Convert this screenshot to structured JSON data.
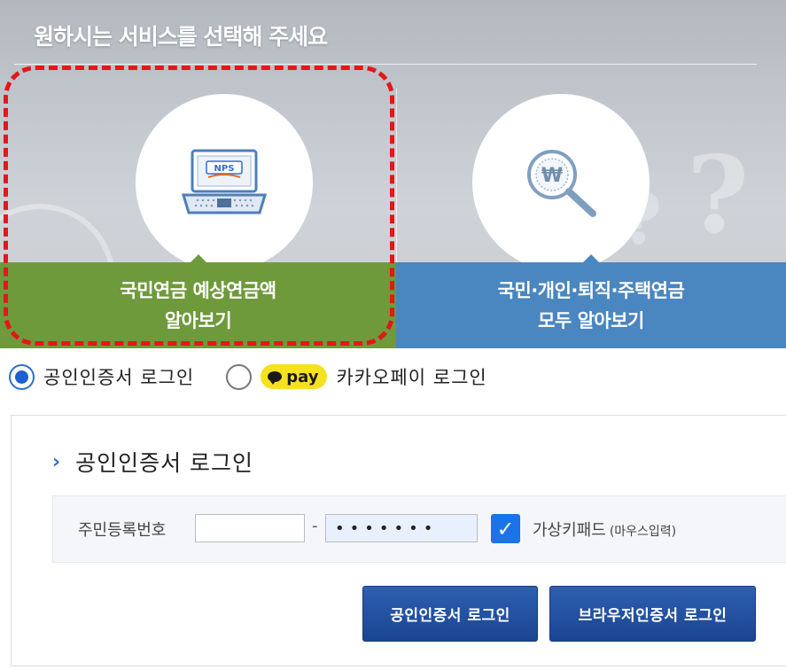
{
  "banner": {
    "title": "원하시는 서비스를 선택해 주세요",
    "cards": [
      {
        "line1": "국민연금 예상연금액",
        "line2": "알아보기",
        "icon": "laptop-nps-icon",
        "icon_text": "NPS",
        "color": "#6e9a3c"
      },
      {
        "line1": "국민·개인·퇴직·주택연금",
        "line2": "모두 알아보기",
        "icon": "magnifier-won-icon",
        "icon_text": "₩",
        "color": "#4a86c0"
      }
    ],
    "highlight_color": "#e3171a"
  },
  "login_methods": {
    "cert_label": "공인인증서 로그인",
    "kakao_badge": "pay",
    "kakao_label": "카카오페이 로그인",
    "selected": "cert"
  },
  "panel": {
    "title": "공인인증서 로그인",
    "id_label": "주민등록번호",
    "rrn_front_value": "",
    "dash": "-",
    "rrn_back_value": "•••••••",
    "virtual_keypad_label": "가상키패드",
    "virtual_keypad_sub": "(마우스입력)",
    "virtual_keypad_checked": true,
    "buttons": {
      "cert_login": "공인인증서 로그인",
      "browser_login": "브라우저인증서 로그인"
    }
  },
  "colors": {
    "accent": "#1a4592",
    "check": "#1a73e8"
  }
}
